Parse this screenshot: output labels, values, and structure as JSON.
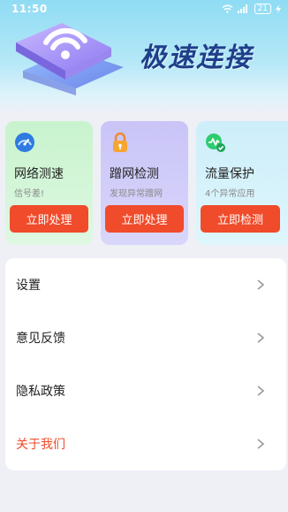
{
  "status_bar": {
    "time": "11:50",
    "battery": "21"
  },
  "hero": {
    "title": "极速连接"
  },
  "cards": [
    {
      "title": "网络测速",
      "subtitle": "信号差!",
      "button": "立即处理",
      "icon": "speedometer-icon"
    },
    {
      "title": "蹭网检测",
      "subtitle": "发现异常蹭网",
      "button": "立即处理",
      "icon": "lock-icon"
    },
    {
      "title": "流量保护",
      "subtitle": "4个异常应用",
      "button": "立即检测",
      "icon": "traffic-shield-icon"
    }
  ],
  "menu": [
    {
      "label": "设置"
    },
    {
      "label": "意见反馈"
    },
    {
      "label": "隐私政策"
    },
    {
      "label": "关于我们"
    }
  ],
  "colors": {
    "accent": "#f04b2a",
    "title": "#1e3f8a"
  }
}
